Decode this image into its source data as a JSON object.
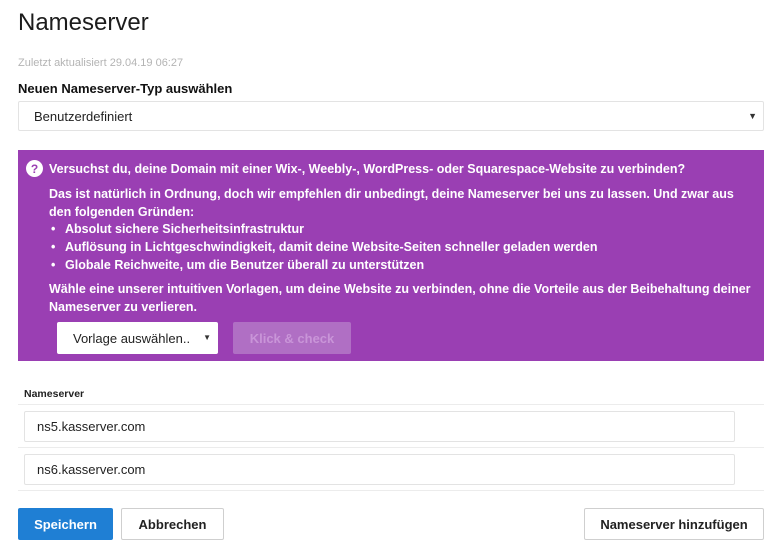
{
  "page": {
    "title": "Nameserver",
    "last_updated": "Zuletzt aktualisiert 29.04.19 06:27"
  },
  "type_select": {
    "label": "Neuen Nameserver-Typ auswählen",
    "selected": "Benutzerdefiniert",
    "chevron_icon": "chevron-down-icon"
  },
  "info_panel": {
    "background": "#9a3fb3",
    "icon": "question-circle-icon",
    "icon_glyph": "?",
    "heading": "Versuchst du, deine Domain mit einer Wix-, Weebly-, WordPress- oder Squarespace-Website zu verbinden?",
    "intro": "Das ist natürlich in Ordnung, doch wir empfehlen dir unbedingt, deine Nameserver bei uns zu lassen. Und zwar aus den folgenden Gründen:",
    "bullet": "•",
    "reasons": [
      "Absolut sichere Sicherheitsinfrastruktur",
      "Auflösung in Lichtgeschwindigkeit, damit deine Website-Seiten schneller geladen werden",
      "Globale Reichweite, um die Benutzer überall zu unterstützen"
    ],
    "outro": "Wähle eine unserer intuitiven Vorlagen, um deine Website zu verbinden, ohne die Vorteile aus der Beibehaltung deiner Nameserver zu verlieren.",
    "template_select": "Vorlage auswählen..",
    "check_button": "Klick & check"
  },
  "nameservers": {
    "label": "Nameserver",
    "entries": [
      "ns5.kasserver.com",
      "ns6.kasserver.com"
    ]
  },
  "actions": {
    "save": "Speichern",
    "cancel": "Abbrechen",
    "add_nameserver": "Nameserver hinzufügen"
  },
  "colors": {
    "accent": "#1f7fd4",
    "panel": "#9a3fb3"
  }
}
